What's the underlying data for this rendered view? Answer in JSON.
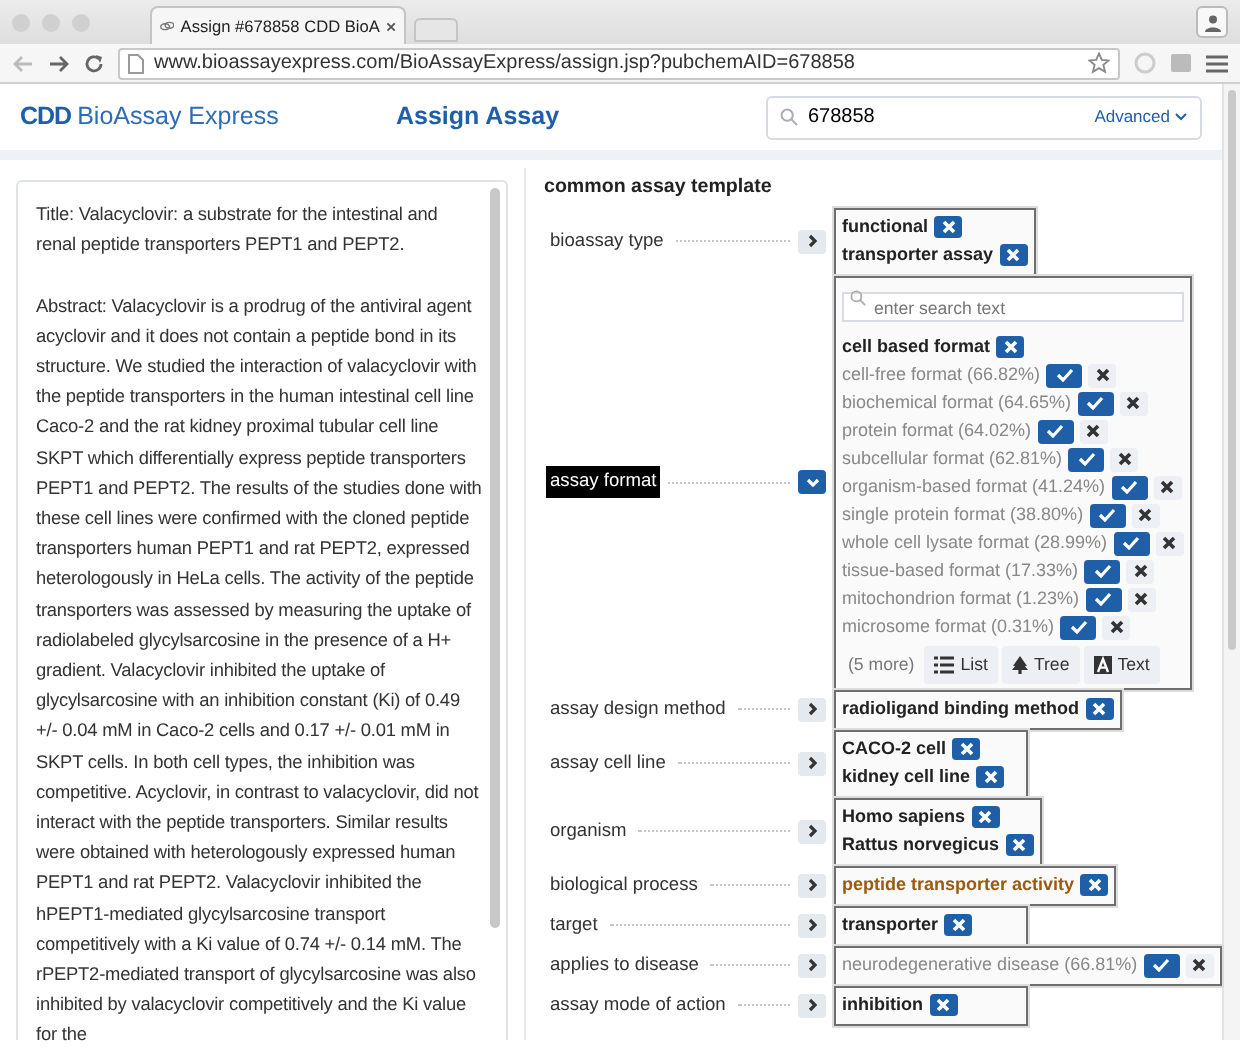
{
  "browser": {
    "tab_title": "Assign #678858 CDD BioA",
    "url": "www.bioassayexpress.com/BioAssayExpress/assign.jsp?pubchemAID=678858"
  },
  "header": {
    "logo_mark": "CDD",
    "logo_text": "BioAssay Express",
    "nav": "Assign Assay",
    "search": {
      "value": "678858"
    },
    "advanced": "Advanced"
  },
  "abstract": {
    "title": "Title: Valacyclovir: a substrate for the intestinal and renal peptide transporters PEPT1 and PEPT2.",
    "body": "Abstract: Valacyclovir is a prodrug of the antiviral agent acyclovir and it does not contain a peptide bond in its structure. We studied the interaction of valacyclovir with the peptide transporters in the human intestinal cell line Caco-2 and the rat kidney proximal tubular cell line SKPT which differentially express peptide transporters PEPT1 and PEPT2. The results of the studies done with these cell lines were confirmed with the cloned peptide transporters human PEPT1 and rat PEPT2, expressed heterologously in HeLa cells. The activity of the peptide transporters was assessed by measuring the uptake of radiolabeled glycylsarcosine in the presence of a H+ gradient. Valacyclovir inhibited the uptake of glycylsarcosine with an inhibition constant (Ki) of 0.49 +/- 0.04 mM in Caco-2 cells and 0.17 +/- 0.01 mM in SKPT cells. In both cell types, the inhibition was competitive. Acyclovir, in contrast to valacyclovir, did not interact with the peptide transporters. Similar results were obtained with heterologously expressed human PEPT1 and rat PEPT2. Valacyclovir inhibited the hPEPT1-mediated glycylsarcosine transport competitively with a Ki value of 0.74 +/- 0.14 mM. The rPEPT2-mediated transport of glycylsarcosine was also inhibited by valacyclovir competitively and the Ki value for the"
  },
  "template": {
    "name": "common assay template",
    "properties": [
      {
        "label": "bioassay type",
        "selected": false,
        "expanded": false,
        "values": [
          {
            "kind": "assigned",
            "text": "functional"
          },
          {
            "kind": "assigned",
            "text": "transporter assay"
          }
        ]
      },
      {
        "label": "assay format",
        "selected": true,
        "expanded": true,
        "search": {
          "placeholder": "enter search text"
        },
        "values": [
          {
            "kind": "assigned",
            "text": "cell based format"
          },
          {
            "kind": "suggested",
            "text": "cell-free format (66.82%)"
          },
          {
            "kind": "suggested",
            "text": "biochemical format (64.65%)"
          },
          {
            "kind": "suggested",
            "text": "protein format (64.02%)"
          },
          {
            "kind": "suggested",
            "text": "subcellular format (62.81%)"
          },
          {
            "kind": "suggested",
            "text": "organism-based format (41.24%)"
          },
          {
            "kind": "suggested",
            "text": "single protein format (38.80%)"
          },
          {
            "kind": "suggested",
            "text": "whole cell lysate format (28.99%)"
          },
          {
            "kind": "suggested",
            "text": "tissue-based format (17.33%)"
          },
          {
            "kind": "suggested",
            "text": "mitochondrion format (1.23%)"
          },
          {
            "kind": "suggested",
            "text": "microsome format (0.31%)"
          }
        ],
        "more": "(5 more)",
        "buttons": [
          {
            "kind": "list",
            "label": "List"
          },
          {
            "kind": "tree",
            "label": "Tree"
          },
          {
            "kind": "text",
            "label": "Text"
          }
        ]
      },
      {
        "label": "assay design method",
        "selected": false,
        "expanded": false,
        "values": [
          {
            "kind": "assigned",
            "text": "radioligand binding method"
          }
        ]
      },
      {
        "label": "assay cell line",
        "selected": false,
        "expanded": false,
        "values": [
          {
            "kind": "assigned",
            "text": "CACO-2 cell"
          },
          {
            "kind": "assigned",
            "text": "kidney cell line"
          }
        ]
      },
      {
        "label": "organism",
        "selected": false,
        "expanded": false,
        "values": [
          {
            "kind": "assigned",
            "text": "Homo sapiens"
          },
          {
            "kind": "assigned",
            "text": "Rattus norvegicus"
          }
        ]
      },
      {
        "label": "biological process",
        "selected": false,
        "expanded": false,
        "values": [
          {
            "kind": "inferred",
            "text": "peptide transporter activity"
          }
        ]
      },
      {
        "label": "target",
        "selected": false,
        "expanded": false,
        "values": [
          {
            "kind": "assigned",
            "text": "transporter"
          }
        ]
      },
      {
        "label": "applies to disease",
        "selected": false,
        "expanded": false,
        "values": [
          {
            "kind": "suggested",
            "text": "neurodegenerative disease (66.81%)"
          }
        ]
      },
      {
        "label": "assay mode of action",
        "selected": false,
        "expanded": false,
        "values": [
          {
            "kind": "assigned",
            "text": "inhibition"
          }
        ]
      }
    ]
  }
}
